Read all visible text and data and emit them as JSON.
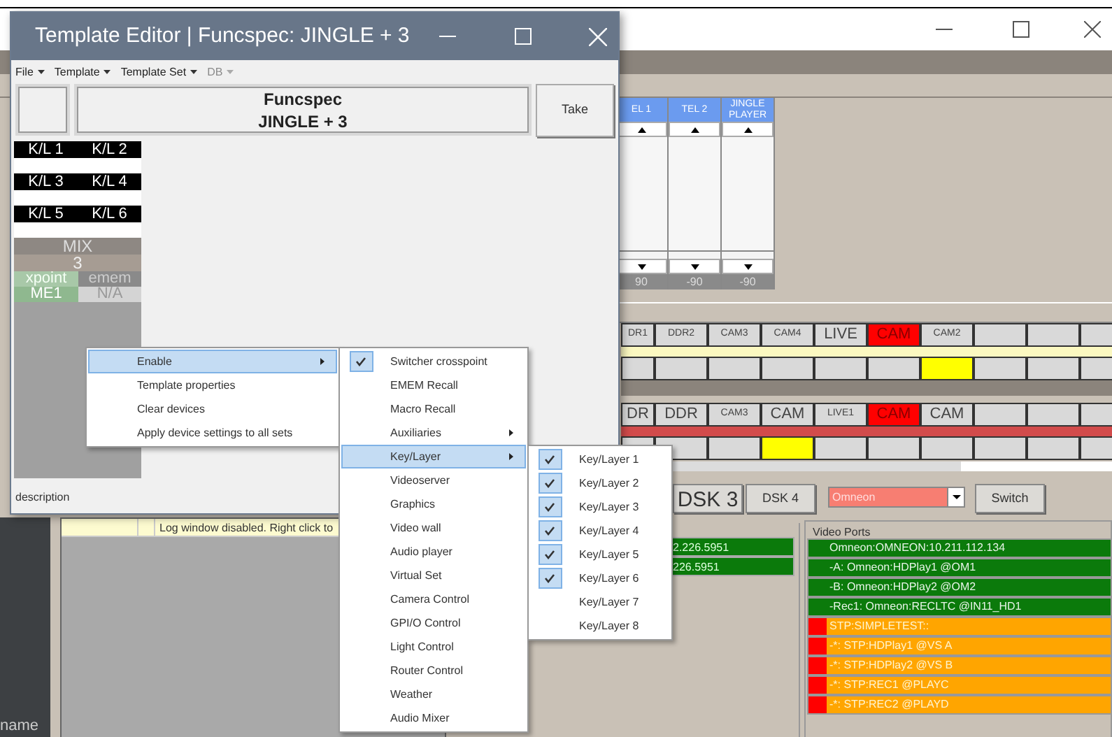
{
  "main_window": {
    "audio_channels": [
      {
        "label": "EL 1",
        "value": "90"
      },
      {
        "label": "TEL 2",
        "value": "-90"
      },
      {
        "label": "JINGLE PLAYER",
        "value": "-90"
      }
    ],
    "crosspoint_rows": [
      {
        "sources": [
          {
            "label": "DR1",
            "kind": "small",
            "selected": false
          },
          {
            "label": "DDR2",
            "kind": "small",
            "selected": false
          },
          {
            "label": "CAM3",
            "kind": "small",
            "selected": false
          },
          {
            "label": "CAM4",
            "kind": "small",
            "selected": false
          },
          {
            "label": "LIVE",
            "kind": "large",
            "selected": false
          },
          {
            "label": "CAM",
            "kind": "large",
            "selected": true
          },
          {
            "label": "CAM2",
            "kind": "small",
            "selected": false
          },
          {
            "kind": "blank",
            "selected": false
          },
          {
            "kind": "blank",
            "selected": false
          },
          {
            "kind": "blank",
            "selected": false
          }
        ],
        "color": "#fbf8c0",
        "tally": [
          false,
          false,
          false,
          false,
          false,
          false,
          true,
          false,
          false,
          false
        ]
      },
      {
        "sources": [
          {
            "label": "DR",
            "kind": "large",
            "selected": false
          },
          {
            "label": "DDR",
            "kind": "large",
            "selected": false
          },
          {
            "label": "CAM3",
            "kind": "small",
            "selected": false
          },
          {
            "label": "CAM",
            "kind": "large",
            "selected": false
          },
          {
            "label": "LIVE1",
            "kind": "small",
            "selected": false
          },
          {
            "label": "CAM",
            "kind": "large",
            "selected": true
          },
          {
            "label": "CAM",
            "kind": "large",
            "selected": false
          },
          {
            "kind": "blank",
            "selected": false
          },
          {
            "kind": "blank",
            "selected": false
          },
          {
            "kind": "blank",
            "selected": false
          }
        ],
        "color": "#d24b4b",
        "tally": [
          false,
          false,
          false,
          true,
          false,
          false,
          false,
          false,
          false,
          false
        ]
      }
    ],
    "dsk_buttons": [
      {
        "label": "DSK 3",
        "kind": "large"
      },
      {
        "label": "DSK 4",
        "kind": "small"
      }
    ],
    "device_select": {
      "value": "Omneon"
    },
    "switch_button": "Switch",
    "devices": [
      {
        "text": "2.226.5951",
        "alert": false
      },
      {
        "text": "226.5951",
        "alert": false
      }
    ],
    "video_ports": {
      "title": "Video Ports",
      "rows": [
        {
          "text": "Omneon:OMNEON:10.211.112.134",
          "alert": false
        },
        {
          "text": "-A: Omneon:HDPlay1 @OM1",
          "alert": false
        },
        {
          "text": "-B: Omneon:HDPlay2 @OM2",
          "alert": false
        },
        {
          "text": "-Rec1: Omneon:RECLTC @IN11_HD1",
          "alert": false
        },
        {
          "text": "STP:SIMPLETEST::",
          "alert": true
        },
        {
          "text": "-*: STP:HDPlay1 @VS A",
          "alert": true
        },
        {
          "text": "-*: STP:HDPlay2 @VS B",
          "alert": true
        },
        {
          "text": "-*: STP:REC1 @PLAYC",
          "alert": true
        },
        {
          "text": "-*: STP:REC2 @PLAYD",
          "alert": true
        }
      ]
    },
    "log_message": "Log window disabled. Right click to",
    "name_label": "name"
  },
  "editor_window": {
    "title": "Template Editor | Funcspec: JINGLE + 3",
    "menus": [
      {
        "label": "File",
        "disabled": false
      },
      {
        "label": "Template",
        "disabled": false
      },
      {
        "label": "Template Set",
        "disabled": false
      },
      {
        "label": "DB",
        "disabled": true
      }
    ],
    "funcspec": [
      "Funcspec",
      "JINGLE + 3"
    ],
    "take_button": "Take",
    "keyers": [
      [
        "K/L 1",
        "K/L 2"
      ],
      [
        "K/L 3",
        "K/L 4"
      ],
      [
        "K/L 5",
        "K/L 6"
      ]
    ],
    "mix": {
      "label": "MIX",
      "number": "3",
      "type": "xpoint",
      "emem": "emem",
      "bus": "ME1",
      "emem_value": "N/A"
    },
    "status": "description"
  },
  "context_menu": [
    {
      "label": "Enable",
      "highlighted": true,
      "submenu": true
    },
    {
      "label": "Template properties",
      "highlighted": false,
      "submenu": false
    },
    {
      "label": "Clear devices",
      "highlighted": false,
      "submenu": false
    },
    {
      "label": "Apply device settings to all sets",
      "highlighted": false,
      "submenu": false
    }
  ],
  "enable_menu": [
    {
      "label": "Switcher crosspoint",
      "checked": true,
      "highlighted": false,
      "submenu": false
    },
    {
      "label": "EMEM Recall",
      "checked": false,
      "highlighted": false,
      "submenu": false
    },
    {
      "label": "Macro Recall",
      "checked": false,
      "highlighted": false,
      "submenu": false
    },
    {
      "label": "Auxiliaries",
      "checked": false,
      "highlighted": false,
      "submenu": true
    },
    {
      "label": "Key/Layer",
      "checked": false,
      "highlighted": true,
      "submenu": true
    },
    {
      "label": "Videoserver",
      "checked": false,
      "highlighted": false,
      "submenu": false
    },
    {
      "label": "Graphics",
      "checked": false,
      "highlighted": false,
      "submenu": false
    },
    {
      "label": "Video wall",
      "checked": false,
      "highlighted": false,
      "submenu": false
    },
    {
      "label": "Audio player",
      "checked": false,
      "highlighted": false,
      "submenu": false
    },
    {
      "label": "Virtual Set",
      "checked": false,
      "highlighted": false,
      "submenu": false
    },
    {
      "label": "Camera Control",
      "checked": false,
      "highlighted": false,
      "submenu": false
    },
    {
      "label": "GPI/O Control",
      "checked": false,
      "highlighted": false,
      "submenu": false
    },
    {
      "label": "Light Control",
      "checked": false,
      "highlighted": false,
      "submenu": false
    },
    {
      "label": "Router Control",
      "checked": false,
      "highlighted": false,
      "submenu": false
    },
    {
      "label": "Weather",
      "checked": false,
      "highlighted": false,
      "submenu": false
    },
    {
      "label": "Audio Mixer",
      "checked": false,
      "highlighted": false,
      "submenu": false
    }
  ],
  "key_layer_menu": [
    {
      "label": "Key/Layer 1",
      "checked": true
    },
    {
      "label": "Key/Layer 2",
      "checked": true
    },
    {
      "label": "Key/Layer 3",
      "checked": true
    },
    {
      "label": "Key/Layer 4",
      "checked": true
    },
    {
      "label": "Key/Layer 5",
      "checked": true
    },
    {
      "label": "Key/Layer 6",
      "checked": true
    },
    {
      "label": "Key/Layer 7",
      "checked": false
    },
    {
      "label": "Key/Layer 8",
      "checked": false
    }
  ]
}
